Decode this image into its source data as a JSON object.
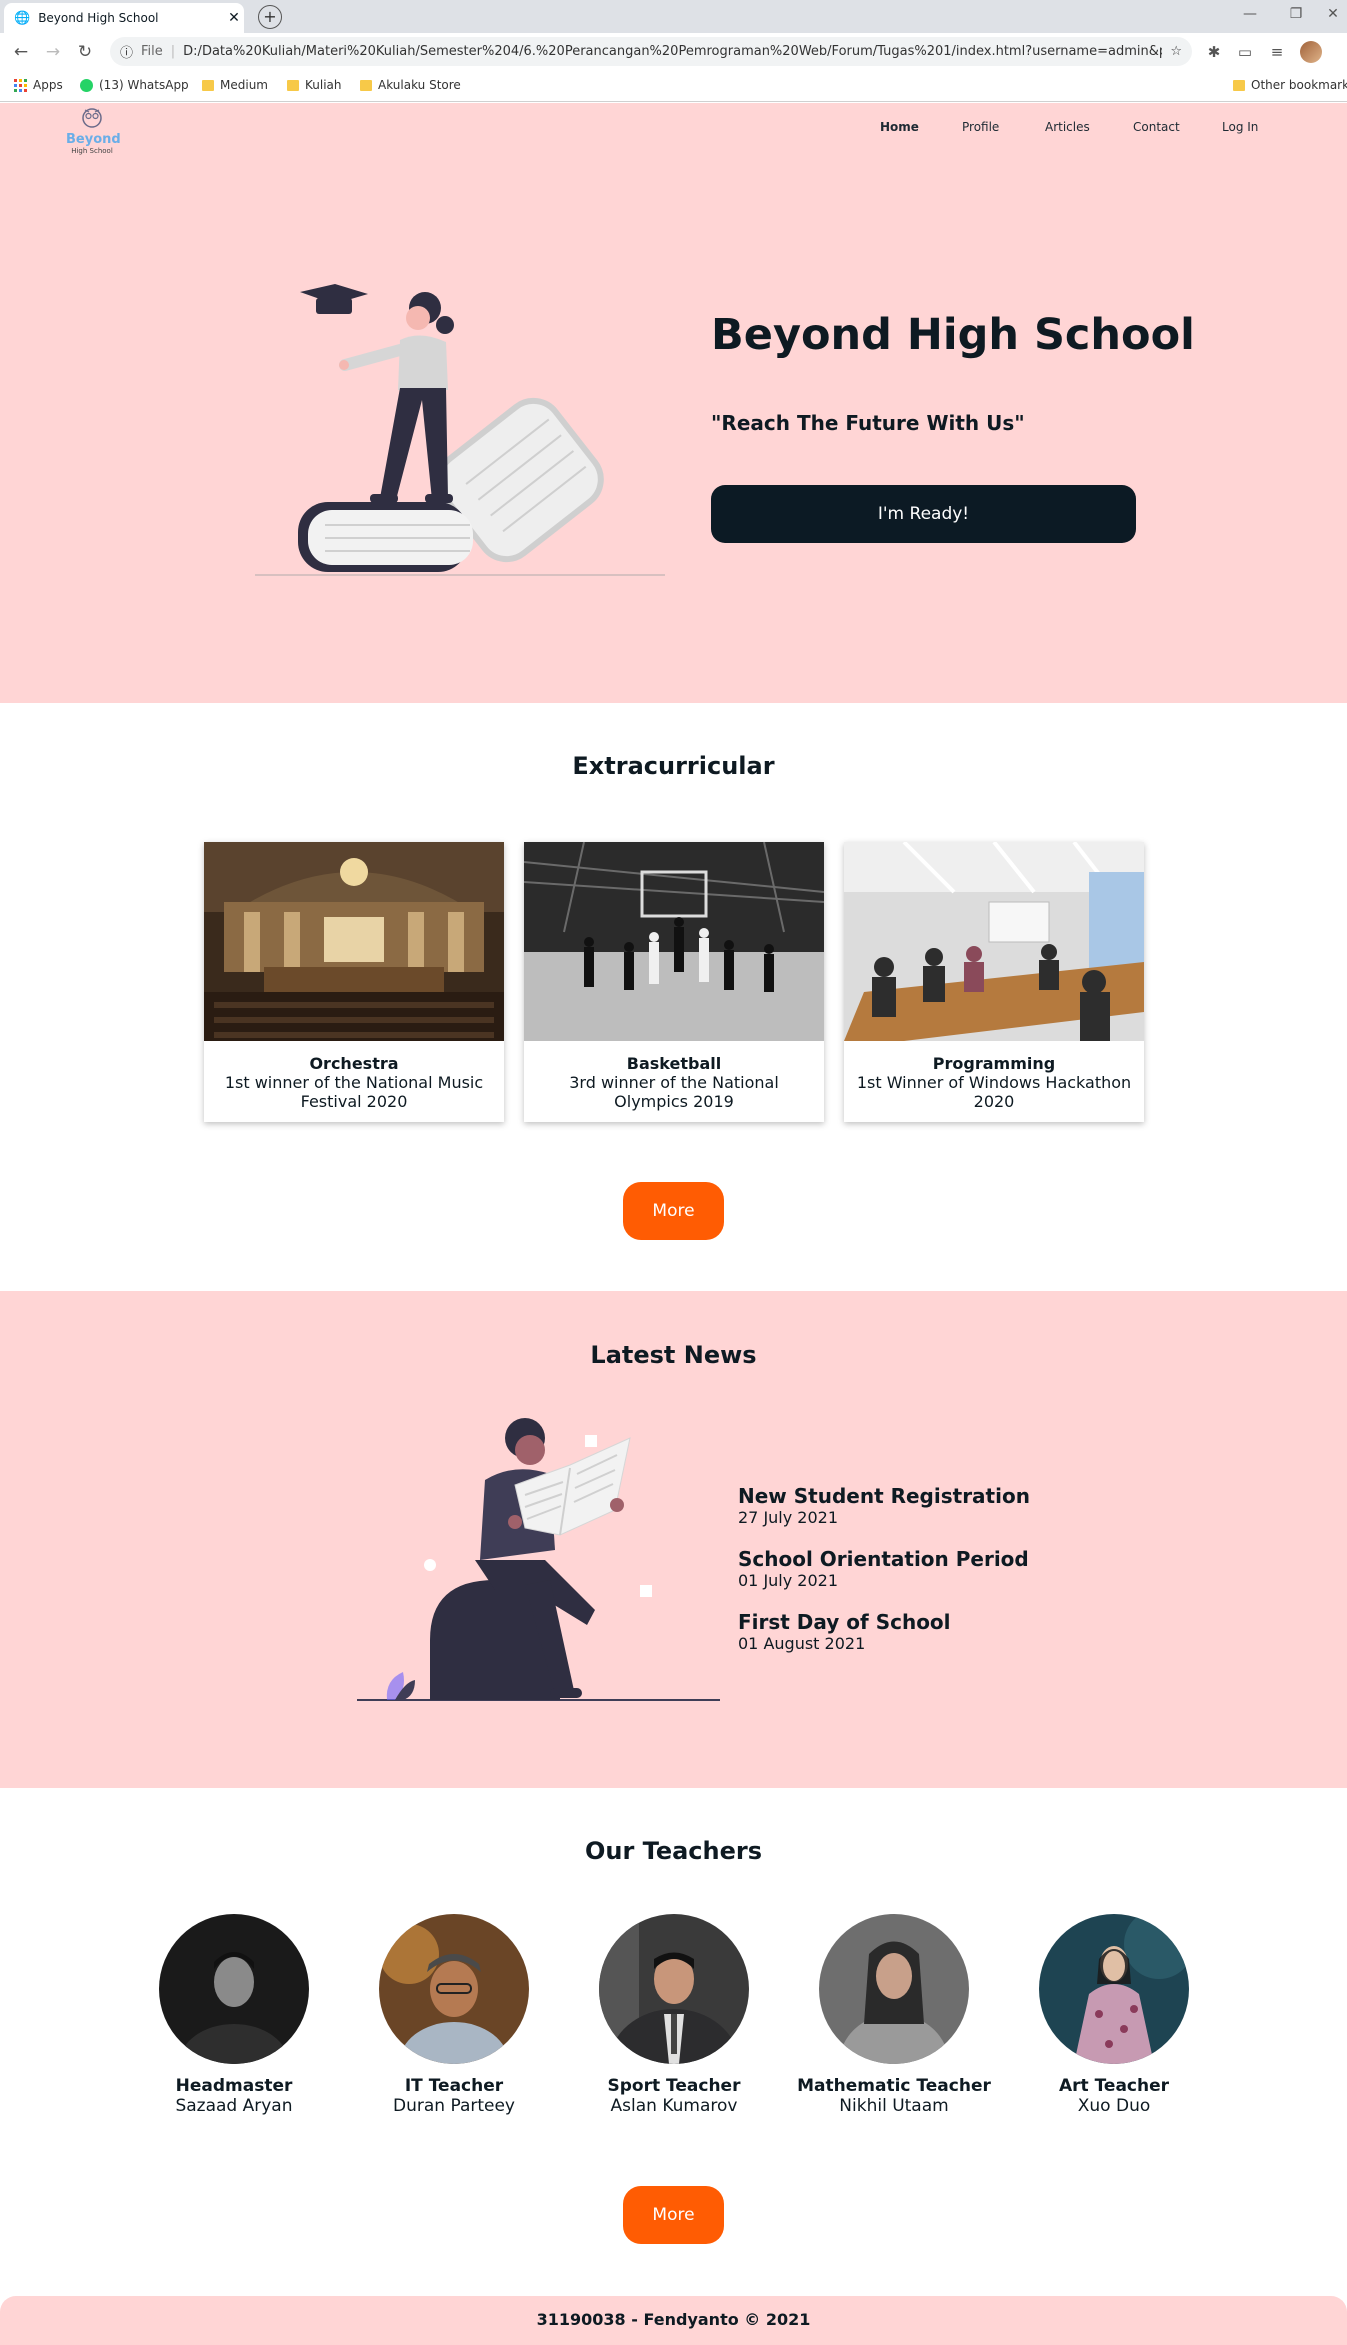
{
  "browser": {
    "tab_title": "Beyond High School",
    "url_scheme": "File",
    "url": "D:/Data%20Kuliah/Materi%20Kuliah/Semester%204/6.%20Perancangan%20Pemrograman%20Web/Forum/Tugas%201/index.html?username=admin&pass...",
    "bookmarks": [
      "Apps",
      "(13) WhatsApp",
      "Medium",
      "Kuliah",
      "Akulaku Store"
    ],
    "other_bookmarks": "Other bookmarks"
  },
  "header": {
    "logo_text": "Beyond",
    "logo_sub": "High School",
    "nav": [
      "Home",
      "Profile",
      "Articles",
      "Contact",
      "Log In"
    ]
  },
  "hero": {
    "title": "Beyond High School",
    "subtitle": "\"Reach The Future With Us\"",
    "cta": "I'm Ready!"
  },
  "extracurricular": {
    "title": "Extracurricular",
    "items": [
      {
        "name": "Orchestra",
        "desc": "1st winner of the National Music Festival 2020"
      },
      {
        "name": "Basketball",
        "desc": "3rd winner of the National Olympics 2019"
      },
      {
        "name": "Programming",
        "desc": "1st Winner of Windows Hackathon 2020"
      }
    ],
    "more": "More"
  },
  "news": {
    "title": "Latest News",
    "items": [
      {
        "title": "New Student Registration",
        "date": "27 July 2021"
      },
      {
        "title": "School Orientation Period",
        "date": "01 July 2021"
      },
      {
        "title": "First Day of School",
        "date": "01 August 2021"
      }
    ]
  },
  "teachers": {
    "title": "Our Teachers",
    "items": [
      {
        "role": "Headmaster",
        "name": "Sazaad Aryan"
      },
      {
        "role": "IT Teacher",
        "name": "Duran Parteey"
      },
      {
        "role": "Sport Teacher",
        "name": "Aslan Kumarov"
      },
      {
        "role": "Mathematic Teacher",
        "name": "Nikhil Utaam"
      },
      {
        "role": "Art Teacher",
        "name": "Xuo Duo"
      }
    ],
    "more": "More"
  },
  "footer": {
    "text": "31190038 - Fendyanto © 2021"
  },
  "colors": {
    "pink": "#ffd5d5",
    "navy": "#0c1a24",
    "orange": "#ff5c03"
  }
}
